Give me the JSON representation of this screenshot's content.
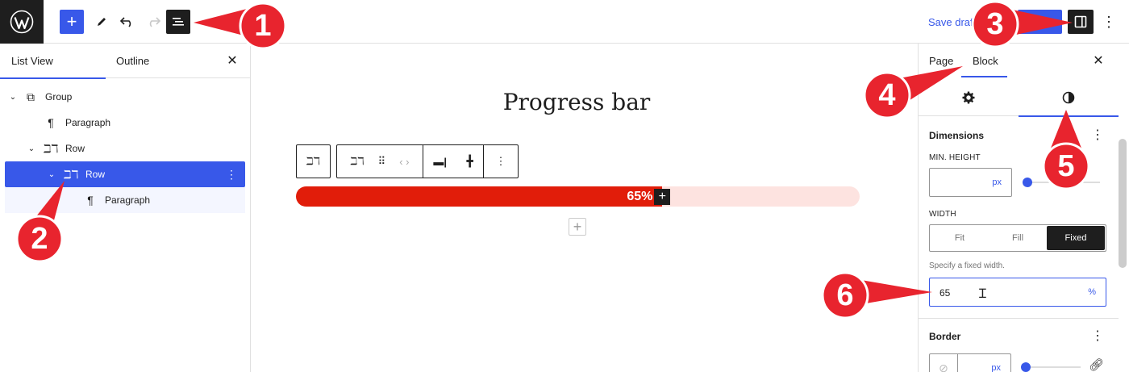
{
  "topbar": {
    "save_draft": "Save draft",
    "icons": [
      "wordpress-logo",
      "plus-icon",
      "pen-icon",
      "undo-icon",
      "redo-icon",
      "list-view-icon",
      "sidebar-toggle-icon",
      "more-vertical-icon"
    ]
  },
  "list_view": {
    "tab_list": "List View",
    "tab_outline": "Outline",
    "items": [
      {
        "label": "Group",
        "icon": "group-icon"
      },
      {
        "label": "Paragraph",
        "icon": "paragraph-icon"
      },
      {
        "label": "Row",
        "icon": "row-icon"
      },
      {
        "label": "Row",
        "icon": "row-icon",
        "selected": true
      },
      {
        "label": "Paragraph",
        "icon": "paragraph-icon"
      }
    ]
  },
  "canvas": {
    "title": "Progress bar",
    "progress_text": "65%",
    "progress_value": 0.65,
    "colors": {
      "fill": "#e11d0a",
      "track": "#fde3e0"
    }
  },
  "sidebar": {
    "tab_page": "Page",
    "tab_block": "Block",
    "dimensions": {
      "heading": "Dimensions",
      "min_height_label": "MIN. HEIGHT",
      "min_height_unit": "px",
      "width_label": "WIDTH",
      "width_options": [
        "Fit",
        "Fill",
        "Fixed"
      ],
      "width_selected": "Fixed",
      "help": "Specify a fixed width.",
      "width_value": "65",
      "width_unit": "%"
    },
    "border": {
      "heading": "Border",
      "unit": "px"
    }
  },
  "callouts": [
    "1",
    "2",
    "3",
    "4",
    "5",
    "6"
  ],
  "colors": {
    "accent": "#3858e9",
    "callout": "#e8242e"
  }
}
